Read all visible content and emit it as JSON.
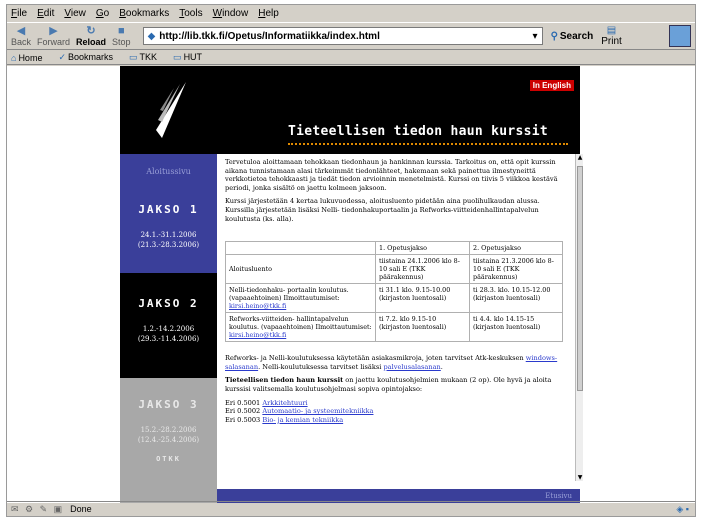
{
  "browser": {
    "menu": [
      "File",
      "Edit",
      "View",
      "Go",
      "Bookmarks",
      "Tools",
      "Window",
      "Help"
    ],
    "toolbar": {
      "back": "Back",
      "forward": "Forward",
      "reload": "Reload",
      "stop": "Stop",
      "url": "http://lib.tkk.fi/Opetus/Informatiikka/index.html",
      "search": "Search",
      "print": "Print"
    },
    "bookmarks": [
      "Home",
      "Bookmarks",
      "TKK",
      "HUT"
    ],
    "status": "Done"
  },
  "page": {
    "in_english": "In English",
    "title": "Tieteellisen tiedon haun kurssit",
    "sidebar": {
      "nav": "Aloitussivu",
      "j1_title": "JAKSO 1",
      "j1_dates": [
        "24.1.-31.1.2006",
        "(21.3.-28.3.2006)"
      ],
      "j2_title": "JAKSO 2",
      "j2_dates": [
        "1.2.-14.2.2006",
        "(29.3.-11.4.2006)"
      ],
      "j3_title": "JAKSO 3",
      "j3_dates": [
        "15.2.-28.2.2006",
        "(12.4.-25.4.2006)"
      ],
      "j3_extra": "OTKK"
    },
    "intro1": "Tervetuloa aloittamaan tehokkaan tiedonhaun ja hankinnan kurssia. Tarkoitus on, että opit kurssin aikana tunnistamaan alasi tärkeimmät tiedonlähteet, hakemaan sekä painettua ilmestyneittä verkkotietoa tehokkaasti ja tiedät tiedon arvioinnin menetelmistä. Kurssi on tiivis 5 viikkoa kestävä periodi, jonka sisältö on jaettu kolmeen jaksoon.",
    "intro2": "Kurssi järjestetään 4 kertaa lukuvuodessa, aloitusluento pidetään aina puolihulkaudan alussa. Kurssilla järjestetään lisäksi Nelli- tiedonhakuportaalin ja Refworks-viitteidenhallintapalvelun koulutusta (ks. alla).",
    "table": {
      "head": [
        "",
        "1. Opetusjakso",
        "2. Opetusjakso"
      ],
      "rows": [
        {
          "label": "Aloitusluento",
          "link": "",
          "c1": "tiistaina 24.1.2006 klo 8-10 sali E (TKK päärakennus)",
          "c2": "tiistaina 21.3.2006 klo 8-10 sali E (TKK päärakennus)"
        },
        {
          "label": "Nelli-tiedonhaku- portaalin koulutus. (vapaaehtoinen) Ilmoittautumiset:",
          "link": "kirsi.heino@tkk.fi",
          "c1": "ti 31.1 klo. 9.15-10.00 (kirjaston luentosali)",
          "c2": "ti 28.3. klo. 10.15-12.00 (kirjaston luentosali)"
        },
        {
          "label": "Refworks-viitteiden- hallintapalvelun koulutus. (vapaaehtoinen) Ilmoittautumiset:",
          "link": "kirsi.heino@tkk.fi",
          "c1": "ti 7.2. klo 9.15-10 (kirjaston luentosali)",
          "c2": "ti 4.4. klo 14.15-15 (kirjaston luentosali)"
        }
      ]
    },
    "after_table": {
      "text1": "Refworks- ja Nelli-koulutuksessa käytetään asiakasmikroja, joten tarvitset Atk-keskuksen",
      "link1": "windows-salasanan",
      "text2": ". Nelli-koulutuksessa tarvitset lisäksi",
      "link2": "palvelusalasanan",
      "text3": "."
    },
    "para_bold": "Tieteellisen tiedon haun kurssit",
    "para_rest": " on jaettu koulutusohjelmien mukaan (2 op). Ole hyvä ja aloita kurssisi valitsemalla koulutusohjelmasi sopiva opintojakso:",
    "courses": [
      {
        "code": "Eri 0.5001",
        "name": "Arkkitehtuuri"
      },
      {
        "code": "Eri 0.5002",
        "name": "Automaatio- ja systeemitekniikka"
      },
      {
        "code": "Eri 0.5003",
        "name": "Bio- ja kemian tekniikka"
      }
    ],
    "footer": "Etusivu"
  }
}
